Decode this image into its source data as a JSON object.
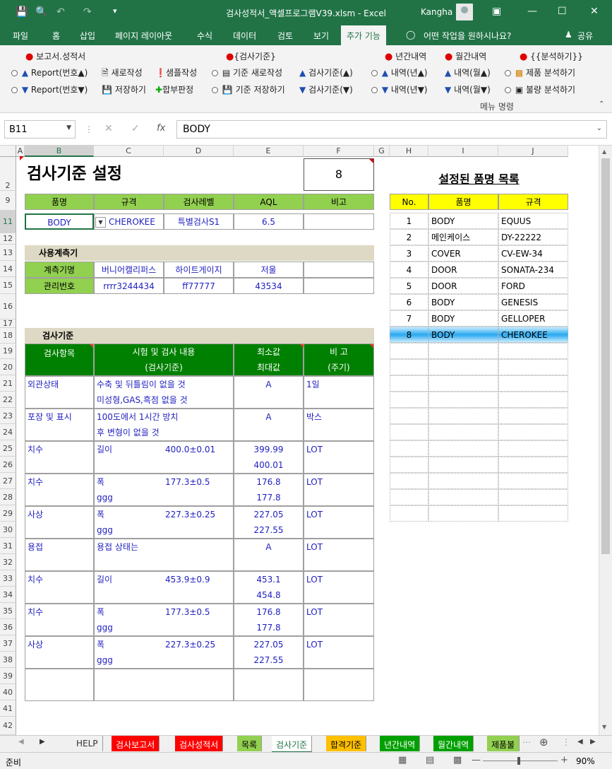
{
  "titlebar": {
    "title": "검사성적서_액셀프로그램V39.xlsm  -  Excel",
    "user": "Kangha",
    "icons": [
      "save-icon",
      "print-preview-icon",
      "undo-icon",
      "redo-icon",
      "customize-icon"
    ],
    "window_controls": [
      "ribbon-display-icon",
      "minimize-icon",
      "maximize-icon",
      "close-icon"
    ]
  },
  "tabs": [
    "파일",
    "홈",
    "삽입",
    "페이지 레이아웃",
    "수식",
    "데이터",
    "검토",
    "보기",
    "추가 기능"
  ],
  "tell_me": "어떤 작업을 원하시나요?",
  "share": "공유",
  "ribbon": {
    "group1_title": "보고서.성적서",
    "group2_title": "{검사기준}",
    "group3a_title": "년간내역",
    "group3b_title": "월간내역",
    "group4_title": "{{분석하기}}",
    "r1": [
      "Report(번호▲)",
      "새로작성",
      "샘플작성",
      "기준 새로작성",
      "검사기준(▲)",
      "내역(년▲)",
      "내역(월▲)",
      "제품 분석하기"
    ],
    "r2": [
      "Report(번호▼)",
      "저장하기",
      "합부판정",
      "기준 저장하기",
      "검사기준(▼)",
      "내역(년▼)",
      "내역(월▼)",
      "불량 분석하기"
    ],
    "footer": "메뉴 명령"
  },
  "formula": {
    "namebox": "B11",
    "fx": "fx",
    "value": "BODY"
  },
  "columns": [
    "A",
    "B",
    "C",
    "D",
    "E",
    "F",
    "G",
    "H",
    "I",
    "J"
  ],
  "rows": [
    "2",
    "9",
    "11",
    "12",
    "13",
    "14",
    "15",
    "16",
    "17",
    "18",
    "19",
    "20",
    "21",
    "22",
    "23",
    "24",
    "25",
    "26",
    "27",
    "28",
    "29",
    "30",
    "31",
    "32",
    "33",
    "34",
    "35",
    "36",
    "37",
    "38",
    "39",
    "40",
    "41",
    "42"
  ],
  "sheet": {
    "title": "검사기준 설정",
    "count": "8",
    "head": [
      "품명",
      "규격",
      "검사레벨",
      "AQL",
      "비고"
    ],
    "values": [
      "BODY",
      "CHEROKEE",
      "특별검사S1",
      "6.5",
      ""
    ],
    "instrument_title": "사용계측기",
    "inst_rows": [
      {
        "label": "계측기명",
        "v1": "버니어캘리퍼스",
        "v2": "하이트게이지",
        "v3": "저울"
      },
      {
        "label": "관리번호",
        "v1": "rrrr3244434",
        "v2": "ff77777",
        "v3": "43534"
      }
    ],
    "criteria_title": "검사기준",
    "crit_head": {
      "item": "검사항목",
      "content1": "시험 및 검사 내용",
      "content2": "(검사기준)",
      "minmax1": "최소값",
      "minmax2": "최대값",
      "note1": "비  고",
      "note2": "(주기)"
    },
    "criteria": [
      {
        "item": "외관상태",
        "c1": "수축 및 뒤틀림이 없을 것",
        "c2": "미성형,GAS,흑점 없을 것",
        "spec": "",
        "v1": "A",
        "v2": "",
        "note": "1일"
      },
      {
        "item": "포장 및 표시",
        "c1": "100도에서 1시간 방치",
        "c2": "후 변형이 없을 것",
        "spec": "",
        "v1": "A",
        "v2": "",
        "note": "박스"
      },
      {
        "item": "치수",
        "c1": "길이",
        "c2": "",
        "spec": "400.0±0.01",
        "v1": "399.99",
        "v2": "400.01",
        "note": "LOT"
      },
      {
        "item": "치수",
        "c1": "폭",
        "c2": "ggg",
        "spec": "177.3±0.5",
        "v1": "176.8",
        "v2": "177.8",
        "note": "LOT"
      },
      {
        "item": "사상",
        "c1": "폭",
        "c2": "ggg",
        "spec": "227.3±0.25",
        "v1": "227.05",
        "v2": "227.55",
        "note": "LOT"
      },
      {
        "item": "용접",
        "c1": "용접 상태는",
        "c2": "",
        "spec": "",
        "v1": "A",
        "v2": "",
        "note": "LOT"
      },
      {
        "item": "치수",
        "c1": "길이",
        "c2": "",
        "spec": "453.9±0.9",
        "v1": "453.1",
        "v2": "454.8",
        "note": "LOT"
      },
      {
        "item": "치수",
        "c1": "폭",
        "c2": "ggg",
        "spec": "177.3±0.5",
        "v1": "176.8",
        "v2": "177.8",
        "note": "LOT"
      },
      {
        "item": "사상",
        "c1": "폭",
        "c2": "ggg",
        "spec": "227.3±0.25",
        "v1": "227.05",
        "v2": "227.55",
        "note": "LOT"
      },
      {
        "item": "",
        "c1": "",
        "c2": "",
        "spec": "",
        "v1": "",
        "v2": "",
        "note": ""
      }
    ],
    "list_title": "설정된 품명 목록",
    "list_head": [
      "No.",
      "품명",
      "규격"
    ],
    "list": [
      {
        "no": "1",
        "name": "BODY",
        "spec": "EQUUS"
      },
      {
        "no": "2",
        "name": "메인케이스",
        "spec": "DY-22222"
      },
      {
        "no": "3",
        "name": "COVER",
        "spec": "CV-EW-34"
      },
      {
        "no": "4",
        "name": "DOOR",
        "spec": "SONATA-234"
      },
      {
        "no": "5",
        "name": "DOOR",
        "spec": "FORD"
      },
      {
        "no": "6",
        "name": "BODY",
        "spec": "GENESIS"
      },
      {
        "no": "7",
        "name": "BODY",
        "spec": "GELLOPER"
      },
      {
        "no": "8",
        "name": "BODY",
        "spec": "CHEROKEE"
      }
    ]
  },
  "sheet_tabs": [
    {
      "label": "HELP",
      "color": "#f0f0f0",
      "fg": "#333"
    },
    {
      "label": "검사보고서",
      "color": "#ff0000",
      "fg": "#fff"
    },
    {
      "label": "검사성적서",
      "color": "#ff0000",
      "fg": "#fff"
    },
    {
      "label": "목록",
      "color": "#92d050",
      "fg": "#000"
    },
    {
      "label": "검사기준",
      "color": "#ffffff",
      "fg": "#217346"
    },
    {
      "label": "합격기준",
      "color": "#ffc000",
      "fg": "#000"
    },
    {
      "label": "년간내역",
      "color": "#00a000",
      "fg": "#fff"
    },
    {
      "label": "월간내역",
      "color": "#00a000",
      "fg": "#fff"
    },
    {
      "label": "제품불",
      "color": "#92d050",
      "fg": "#000"
    }
  ],
  "status": {
    "ready": "준비",
    "zoom": "90%"
  }
}
